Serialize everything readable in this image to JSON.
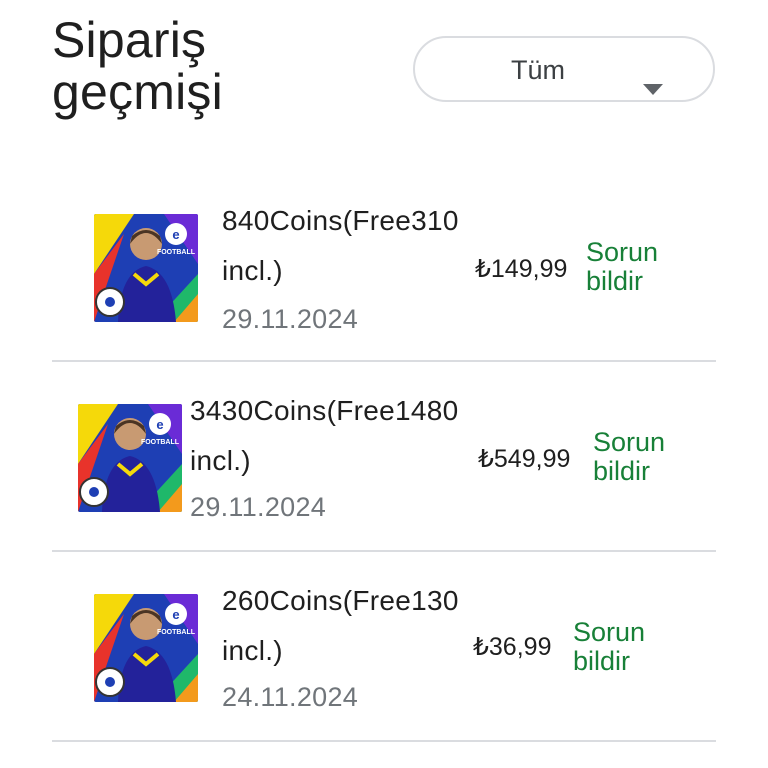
{
  "page": {
    "title": "Sipariş\ngeçmişi"
  },
  "filter": {
    "label": "Tüm"
  },
  "thumbnail": {
    "badge_text": "FOOTBALL",
    "colors": {
      "yellow": "#f5d90a",
      "blue": "#1e3fb4",
      "green": "#1fb86a",
      "red": "#e8332b",
      "purple": "#6a2bd6",
      "orange": "#f39a1c"
    }
  },
  "orders": [
    {
      "name": "840Coins(Free310\nincl.)",
      "date": "29.11.2024",
      "price": "₺149,99",
      "report_label": "Sorun\nbildir"
    },
    {
      "name": "3430Coins(Free1480\nincl.)",
      "date": "29.11.2024",
      "price": "₺549,99",
      "report_label": "Sorun\nbildir"
    },
    {
      "name": "260Coins(Free130\nincl.)",
      "date": "24.11.2024",
      "price": "₺36,99",
      "report_label": "Sorun\nbildir"
    }
  ],
  "colors": {
    "accent_green": "#188038",
    "divider": "#dadce0",
    "date_gray": "#70757a"
  }
}
